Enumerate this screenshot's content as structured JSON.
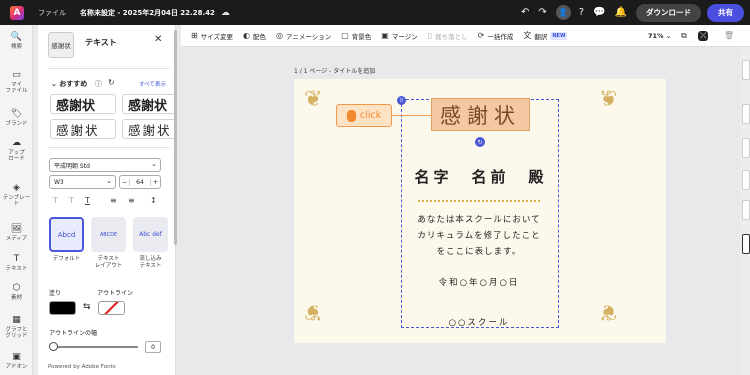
{
  "topbar": {
    "logo": "A",
    "file_menu": "ファイル",
    "doc_title": "名称未設定 - 2025年2月04日 22.28.42",
    "cloud_icon": "☁",
    "download": "ダウンロード",
    "share": "共有",
    "undo_icon": "↶",
    "redo_icon": "↷",
    "user_icon": "👤",
    "help_icon": "?",
    "comment_icon": "💬",
    "bell_icon": "🔔"
  },
  "rail": {
    "items": [
      {
        "icon": "🔍",
        "label": "検索"
      },
      {
        "icon": "▭",
        "label": "マイ\nファイル"
      },
      {
        "icon": "🏷",
        "label": "ブランド"
      },
      {
        "icon": "☁",
        "label": "アップ\nロード"
      },
      {
        "icon": "◈",
        "label": "テンプレー\nト"
      },
      {
        "icon": "🖼",
        "label": "メディア"
      },
      {
        "icon": "T",
        "label": "テキスト"
      },
      {
        "icon": "⬡",
        "label": "素材"
      },
      {
        "icon": "▦",
        "label": "グラフと\nグリッド"
      },
      {
        "icon": "▣",
        "label": "アドオン"
      }
    ]
  },
  "panel": {
    "thumb_text": "感謝状",
    "title": "テキスト",
    "close": "✕",
    "recommended": "おすすめ",
    "info_icon": "ⓘ",
    "refresh_icon": "↻",
    "show_all": "すべて表示",
    "styles": [
      "感謝状",
      "感謝状",
      "感謝状",
      "感謝状"
    ],
    "font_name": "平成明朝 Std",
    "weight": "W3",
    "size_minus": "−",
    "font_size": "64",
    "size_plus": "+",
    "format_icons": [
      "T",
      "T",
      "T",
      "≡",
      "≡",
      "↕"
    ],
    "effects": [
      {
        "thumb": "Abcd",
        "label": "デフォルト"
      },
      {
        "thumb": "ABCDE",
        "label": "テキスト\nレイアウト"
      },
      {
        "thumb": "Abc def",
        "label": "流し込み\nテキスト"
      }
    ],
    "fill_label": "塗り",
    "outline_label": "アウトライン",
    "swap_icon": "⇆",
    "outline_width_label": "アウトラインの幅",
    "outline_width_value": "0",
    "outline_width_fraction": 0,
    "powered": "Powered by Adobe Fonts",
    "fill_color": "#000000"
  },
  "context_bar": {
    "items": [
      {
        "icon": "⊞",
        "label": "サイズ変更",
        "disabled": false
      },
      {
        "icon": "◐",
        "label": "配色",
        "disabled": false
      },
      {
        "icon": "◎",
        "label": "アニメーション",
        "disabled": false
      },
      {
        "icon": "▢",
        "label": "背景色",
        "disabled": false
      },
      {
        "icon": "▣",
        "label": "マージン",
        "disabled": false
      },
      {
        "icon": "▯",
        "label": "裁ち落とし",
        "disabled": true
      },
      {
        "icon": "⟳",
        "label": "一括作成",
        "disabled": false
      },
      {
        "icon": "文",
        "label": "翻訳",
        "disabled": false,
        "badge": "NEW"
      }
    ],
    "zoom": "71%"
  },
  "canvas": {
    "page_label": "1 / 1 ページ - タイトルを追加",
    "heading": "感謝状",
    "name_line": "名字　名前　殿",
    "body": [
      "あなたは本スクールにおいて",
      "カリキュラムを修了したこと",
      "をここに表します。"
    ],
    "date_line": "令和○年○月○日",
    "school_line": "○○スクール",
    "click_tip": "click",
    "handle_icon": "⠿",
    "rotate_icon": "↻",
    "ornament": "❦"
  },
  "colors": {
    "accent": "#4a4fe0",
    "selection": "#4b58d6",
    "highlight_orange": "#f28a30",
    "page_bg": "#fcf8ec",
    "ornament_gold": "#d3b160"
  }
}
